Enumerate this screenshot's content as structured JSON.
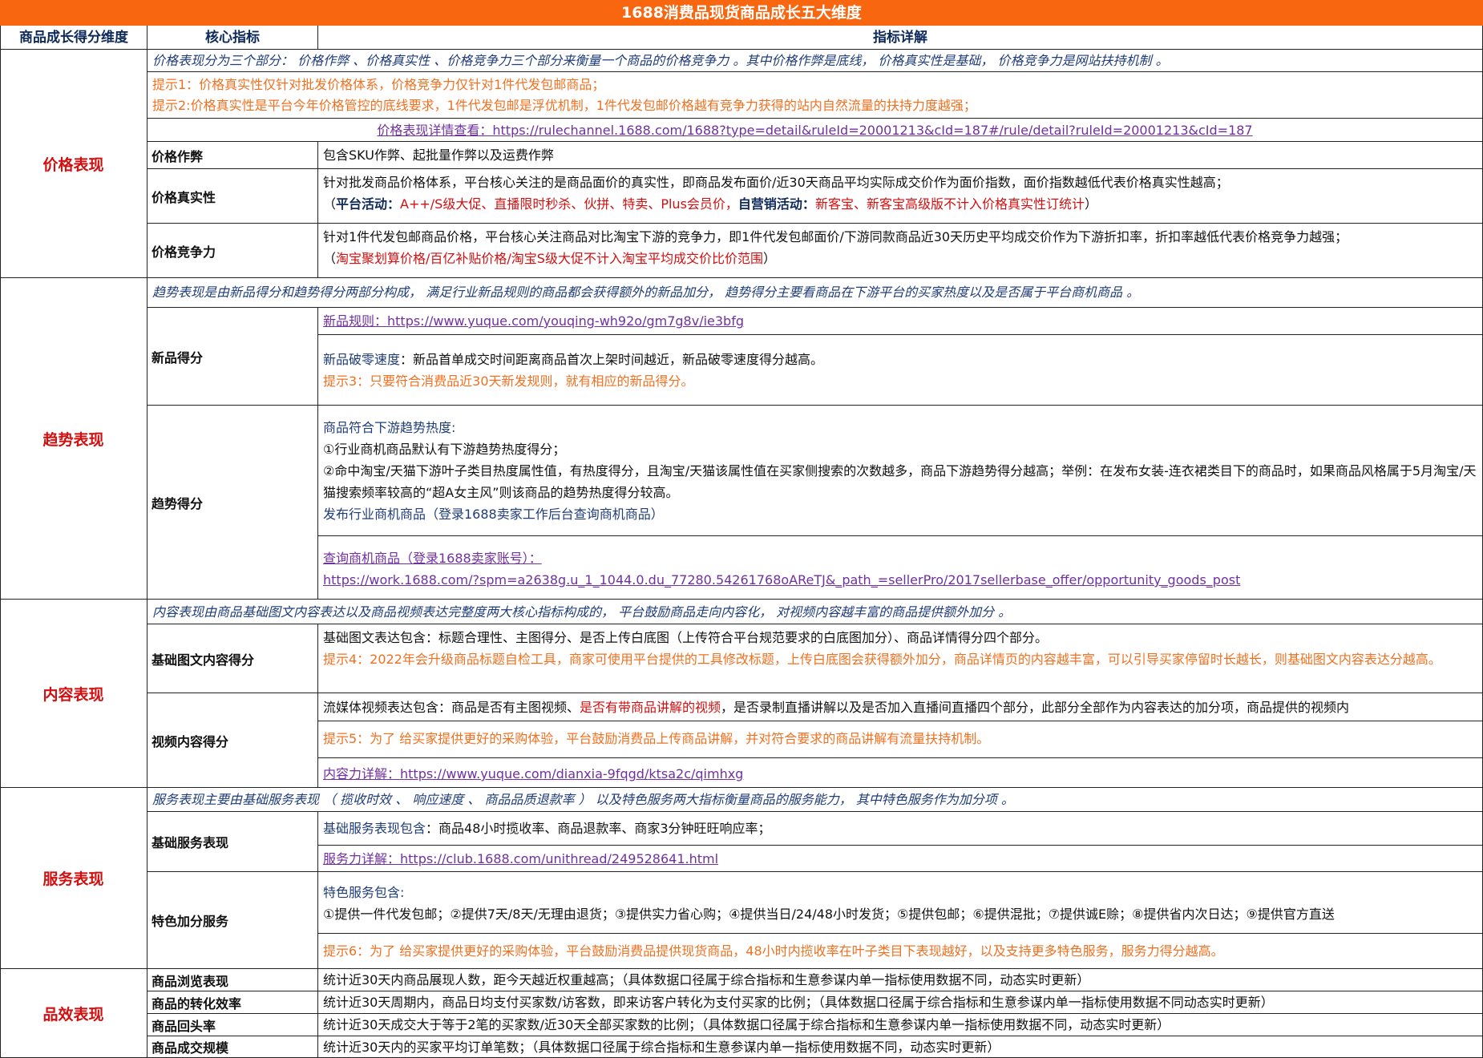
{
  "title": "1688消费品现货商品成长五大维度",
  "headers": {
    "dimension": "商品成长得分维度",
    "indicator": "核心指标",
    "detail": "指标详解"
  },
  "price": {
    "dimension": "价格表现",
    "intro": "价格表现分为三个部分： 价格作弊 、价格真实性 、价格竞争力三个部分来衡量一个商品的价格竞争力 。其中价格作弊是底线， 价格真实性是基础， 价格竞争力是网站扶持机制 。",
    "tip1": "提示1：价格真实性仅针对批发价格体系，价格竞争力仅针对1件代发包邮商品；",
    "tip2": "提示2:价格真实性是平台今年价格管控的底线要求，1件代发包邮是浮优机制，1件代发包邮价格越有竞争力获得的站内自然流量的扶持力度越强；",
    "link": "价格表现详情查看：https://rulechannel.1688.com/1688?type=detail&ruleId=20001213&cId=187#/rule/detail?ruleId=20001213&cId=187",
    "cheat_label": "价格作弊",
    "cheat_detail": "包含SKU作弊、起批量作弊以及运费作弊",
    "authentic_label": "价格真实性",
    "authentic_detail": "针对批发商品价格体系，平台核心关注的是商品面价的真实性，即商品发布面价/近30天商品平均实际成交价作为面价指数，面价指数越低代表价格真实性越高；",
    "authentic_note_open": "（",
    "authentic_note_platform_label": "平台活动：",
    "authentic_note_platform": "A++/S级大促、直播限时秒杀、伙拼、特卖、Plus会员价，",
    "authentic_note_self_label": "自营销活动：",
    "authentic_note_self": "新客宝、新客宝高级版不计入价格真实性订统计",
    "authentic_note_close": "）",
    "compete_label": "价格竞争力",
    "compete_detail": "针对1件代发包邮商品价格，平台核心关注商品对比淘宝下游的竞争力，即1件代发包邮面价/下游同款商品近30天历史平均成交价作为下游折扣率，折扣率越低代表价格竞争力越强；",
    "compete_note_open": "（",
    "compete_note": "淘宝聚划算价格/百亿补贴价格/淘宝S级大促不计入淘宝平均成交价比价范围",
    "compete_note_close": "）"
  },
  "trend": {
    "dimension": "趋势表现",
    "intro": "趋势表现是由新品得分和趋势得分两部分构成， 满足行业新品规则的商品都会获得额外的新品加分， 趋势得分主要看商品在下游平台的买家热度以及是否属于平台商机商品 。",
    "new_label": "新品得分",
    "new_link": "新品规则：https://www.yuque.com/youqing-wh92o/gm7g8v/ie3bfg",
    "new_speed_label": "新品破零速度",
    "new_speed_detail": "：新品首单成交时间距离商品首次上架时间越近，新品破零速度得分越高。",
    "tip3": "提示3：只要符合消费品近30天新发规则，就有相应的新品得分。",
    "trend_label": "趋势得分",
    "heat_title": "商品符合下游趋势热度:",
    "heat_1": "①行业商机商品默认有下游趋势热度得分；",
    "heat_2": "②命中淘宝/天猫下游叶子类目热度属性值，有热度得分，且淘宝/天猫该属性值在买家侧搜索的次数越多，商品下游趋势得分越高；举例：在发布女装-连衣裙类目下的商品时，如果商品风格属于5月淘宝/天猫搜索频率较高的“超A女主风”则该商品的趋势热度得分较高。",
    "publish": "发布行业商机商品（登录1688卖家工作后台查询商机商品）",
    "query_label": "查询商机商品（登录1688卖家账号）：",
    "query_link": "https://work.1688.com/?spm=a2638g.u_1_1044.0.du_77280.54261768oAReTJ&_path_=sellerPro/2017sellerbase_offer/opportunity_goods_post"
  },
  "content": {
    "dimension": "内容表现",
    "intro": "内容表现由商品基础图文内容表达以及商品视频表达完整度两大核心指标构成的， 平台鼓励商品走向内容化， 对视频内容越丰富的商品提供额外加分 。",
    "basic_label": "基础图文内容得分",
    "basic_detail": "基础图文表达包含：标题合理性、主图得分、是否上传白底图（上传符合平台规范要求的白底图加分）、商品详情得分四个部分。",
    "tip4": "提示4：2022年会升级商品标题自检工具，商家可使用平台提供的工具修改标题，上传白底图会获得额外加分，商品详情页的内容越丰富，可以引导买家停留时长越长，则基础图文内容表达分越高。",
    "video_label": "视频内容得分",
    "video_detail_a": "流媒体视频表达包含：商品是否有主图视频、",
    "video_detail_red": "是否有带商品讲解的视频",
    "video_detail_b": "，是否录制直播讲解以及是否加入直播间直播四个部分，此部分全部作为内容表达的加分项，商品提供的视频内",
    "tip5": "提示5：为了 给买家提供更好的采购体验，平台鼓励消费品上传商品讲解，并对符合要求的商品讲解有流量扶持机制。",
    "link": "内容力详解：https://www.yuque.com/dianxia-9fqgd/ktsa2c/qimhxg"
  },
  "service": {
    "dimension": "服务表现",
    "intro": "服务表现主要由基础服务表现 （ 揽收时效 、 响应速度 、 商品品质退款率 ） 以及特色服务两大指标衡量商品的服务能力， 其中特色服务作为加分项 。",
    "basic_label": "基础服务表现",
    "basic_detail_label": "基础服务表现包含",
    "basic_detail": "：商品48小时揽收率、商品退款率、商家3分钟旺旺响应率；",
    "link": "服务力详解：https://club.1688.com/unithread/249528641.html",
    "special_label": "特色加分服务",
    "special_title": "特色服务包含:",
    "special_items": "①提供一件代发包邮；②提供7天/8天/无理由退货；③提供实力省心购；④提供当日/24/48小时发货；⑤提供包邮；⑥提供混批；⑦提供诚E赊；⑧提供省内次日达；⑨提供官方直送",
    "tip6": "提示6：为了 给买家提供更好的采购体验，平台鼓励消费品提供现货商品，48小时内揽收率在叶子类目下表现越好，以及支持更多特色服务，服务力得分越高。"
  },
  "efficiency": {
    "dimension": "品效表现",
    "rows": [
      {
        "label": "商品浏览表现",
        "detail": "统计近30天内商品展现人数，距今天越近权重越高；（具体数据口径属于综合指标和生意参谋内单一指标使用数据不同，动态实时更新）"
      },
      {
        "label": "商品的转化效率",
        "detail": "统计近30天周期内，商品日均支付买家数/访客数，即来访客户转化为支付买家的比例；（具体数据口径属于综合指标和生意参谋内单一指标使用数据不同动态实时更新）"
      },
      {
        "label": "商品回头率",
        "detail": "统计近30天成交大于等于2笔的买家数/近30天全部买家数的比例；（具体数据口径属于综合指标和生意参谋内单一指标使用数据不同，动态实时更新）"
      },
      {
        "label": "商品成交规模",
        "detail": "统计近30天内的买家平均订单笔数；（具体数据口径属于综合指标和生意参谋内单一指标使用数据不同，动态实时更新）"
      }
    ]
  }
}
